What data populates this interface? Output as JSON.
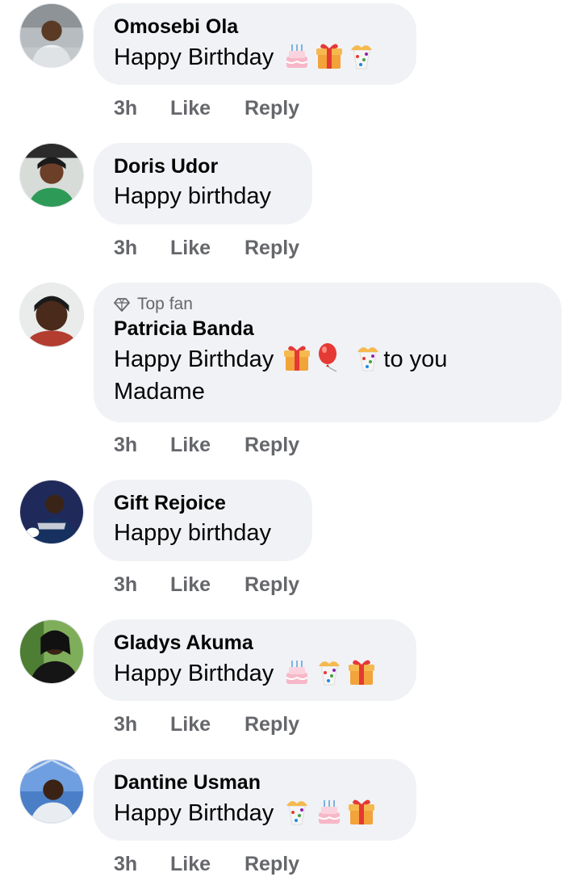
{
  "badge_label": "Top fan",
  "actions": {
    "like_label": "Like",
    "reply_label": "Reply"
  },
  "comments": [
    {
      "author": "Omosebi Ola",
      "lines": [
        "Happy Birthday"
      ],
      "emojis": [
        "cake",
        "gift",
        "confetti"
      ],
      "time": "3h"
    },
    {
      "author": "Doris Udor",
      "lines": [
        "Happy birthday"
      ],
      "emojis": [],
      "time": "3h"
    },
    {
      "author": "Patricia Banda",
      "top_fan": true,
      "lines": [
        "Happy Birthday",
        "to you",
        "Madame"
      ],
      "emojis": [
        "gift",
        "balloon",
        "confetti"
      ],
      "time": "3h"
    },
    {
      "author": "Gift Rejoice",
      "lines": [
        "Happy birthday"
      ],
      "emojis": [],
      "time": "3h"
    },
    {
      "author": "Gladys Akuma",
      "lines": [
        "Happy Birthday"
      ],
      "emojis": [
        "cake",
        "confetti",
        "gift"
      ],
      "time": "3h"
    },
    {
      "author": "Dantine Usman",
      "lines": [
        "Happy Birthday"
      ],
      "emojis": [
        "confetti",
        "cake",
        "gift"
      ],
      "time": "3h"
    }
  ],
  "colors": {
    "bubble": "#f0f2f5",
    "secondary_text": "#65676b",
    "primary_text": "#050505"
  }
}
